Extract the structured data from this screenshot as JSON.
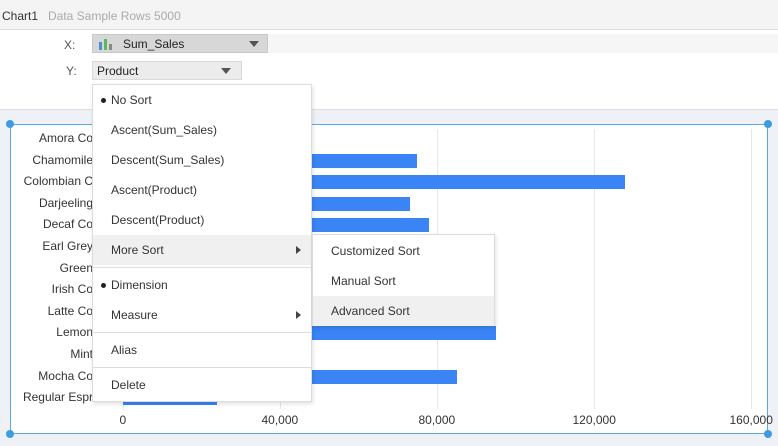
{
  "header": {
    "chart_name": "Chart1",
    "sample_rows": "Data Sample Rows 5000"
  },
  "bindings": {
    "x_label": "X:",
    "x_value": "Sum_Sales",
    "x_icon": "bar-chart-icon",
    "y_label": "Y:",
    "y_value": "Product"
  },
  "chart_data": {
    "type": "bar",
    "orientation": "horizontal",
    "categories": [
      "Amora Cafe",
      "Chamomile",
      "Colombian Coffee",
      "Darjeeling",
      "Decaf Coffee",
      "Earl Grey",
      "Green Tea",
      "Irish Coffee",
      "Latte Coffee",
      "Lemon Tea",
      "Mint",
      "Mocha Coffee",
      "Regular Espresso"
    ],
    "category_labels_visible": [
      "Amora Co",
      "Chamomile",
      "Colombian C",
      "Darjeeling",
      "Decaf Co",
      "Earl Grey",
      "Green",
      "Irish Co",
      "Latte Co",
      "Lemon",
      "Mint",
      "Mocha Co",
      "Regular Espr"
    ],
    "values": [
      null,
      75000,
      128000,
      73000,
      78000,
      null,
      null,
      null,
      null,
      95000,
      null,
      85000,
      24000
    ],
    "x_ticks": [
      "0",
      "40,000",
      "80,000",
      "120,000",
      "160,000"
    ],
    "xlim": [
      0,
      160000
    ],
    "grid": true,
    "series_color": "#3a84f5"
  },
  "menu": {
    "items": [
      {
        "label": "No Sort",
        "checked": true
      },
      {
        "label": "Ascent(Sum_Sales)"
      },
      {
        "label": "Descent(Sum_Sales)"
      },
      {
        "label": "Ascent(Product)"
      },
      {
        "label": "Descent(Product)"
      },
      {
        "label": "More Sort",
        "submenu": true,
        "hovered": true
      },
      {
        "label": "Dimension",
        "checked": true
      },
      {
        "label": "Measure",
        "submenu": true
      },
      {
        "label": "Alias"
      },
      {
        "label": "Delete"
      }
    ],
    "submenu": [
      {
        "label": "Customized Sort"
      },
      {
        "label": "Manual Sort"
      },
      {
        "label": "Advanced Sort",
        "hovered": true
      }
    ]
  }
}
